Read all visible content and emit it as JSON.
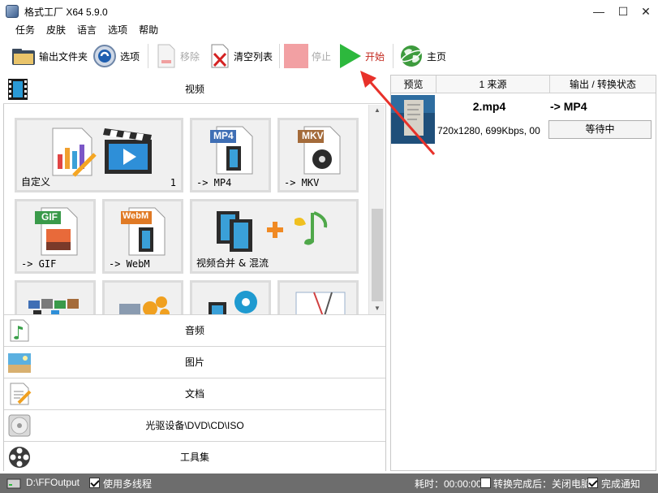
{
  "window": {
    "title": "格式工厂 X64 5.9.0",
    "minimize": "—",
    "maximize": "☐",
    "close": "✕"
  },
  "menu": [
    "任务",
    "皮肤",
    "语言",
    "选项",
    "帮助"
  ],
  "toolbar": {
    "output_folder": "输出文件夹",
    "options": "选项",
    "remove": "移除",
    "clear_list": "清空列表",
    "stop": "停止",
    "start": "开始",
    "home": "主页"
  },
  "categories": {
    "video": "视频",
    "audio": "音频",
    "image": "图片",
    "document": "文档",
    "disc": "光驱设备\\DVD\\CD\\ISO",
    "tools": "工具集"
  },
  "tiles": {
    "custom": {
      "label": "自定义",
      "count": "1"
    },
    "mp4": {
      "label": "-> MP4",
      "badge": "MP4"
    },
    "mkv": {
      "label": "-> MKV",
      "badge": "MKV"
    },
    "gif": {
      "label": "-> GIF",
      "badge": "GIF"
    },
    "webm": {
      "label": "-> WebM",
      "badge": "WebM"
    },
    "merge": {
      "label": "视频合并 & 混流"
    }
  },
  "task_table": {
    "headers": [
      "预览",
      "1 来源",
      "输出 / 转换状态"
    ],
    "rows": [
      {
        "filename": "2.mp4",
        "info": "720x1280, 699Kbps, 00",
        "output": "-> MP4",
        "status": "等待中"
      }
    ]
  },
  "statusbar": {
    "output_path": "D:\\FFOutput",
    "multithread": "使用多线程",
    "time": "耗时：00:00:00",
    "after_convert": "转换完成后：关闭电脑",
    "notify": "完成通知"
  },
  "colors": {
    "accent_red": "#e8312a",
    "start_green": "#2db83d",
    "statusbar": "#6d6d6d"
  }
}
